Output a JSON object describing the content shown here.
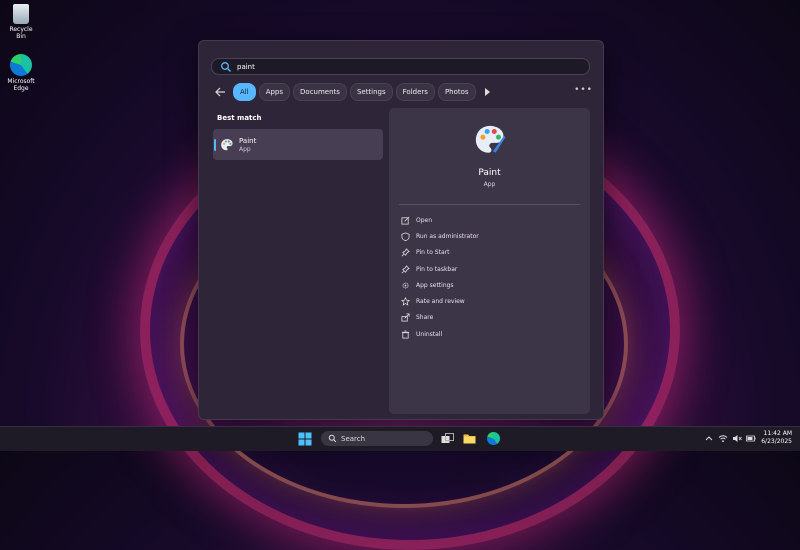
{
  "desktop": {
    "icons": [
      {
        "label": "Recycle Bin",
        "icon": "recycle-bin-icon"
      },
      {
        "label": "Microsoft Edge",
        "icon": "edge-icon"
      }
    ]
  },
  "search": {
    "query": "paint",
    "filters": [
      "All",
      "Apps",
      "Documents",
      "Settings",
      "Folders",
      "Photos"
    ],
    "active_filter": "All",
    "best_match_title": "Best match",
    "result": {
      "name": "Paint",
      "type": "App",
      "icon": "paint-palette-icon"
    },
    "detail": {
      "name": "Paint",
      "type": "App",
      "actions": [
        {
          "label": "Open",
          "icon": "open-icon"
        },
        {
          "label": "Run as administrator",
          "icon": "shield-icon"
        },
        {
          "label": "Pin to Start",
          "icon": "pin-icon"
        },
        {
          "label": "Pin to taskbar",
          "icon": "pin-icon"
        },
        {
          "label": "App settings",
          "icon": "gear-icon"
        },
        {
          "label": "Rate and review",
          "icon": "star-icon"
        },
        {
          "label": "Share",
          "icon": "share-icon"
        },
        {
          "label": "Uninstall",
          "icon": "trash-icon"
        }
      ]
    }
  },
  "taskbar": {
    "search_label": "Search",
    "time": "11:42 AM",
    "date": "6/23/2025"
  },
  "colors": {
    "accent": "#59b7ff",
    "panel": "#2e2638"
  }
}
